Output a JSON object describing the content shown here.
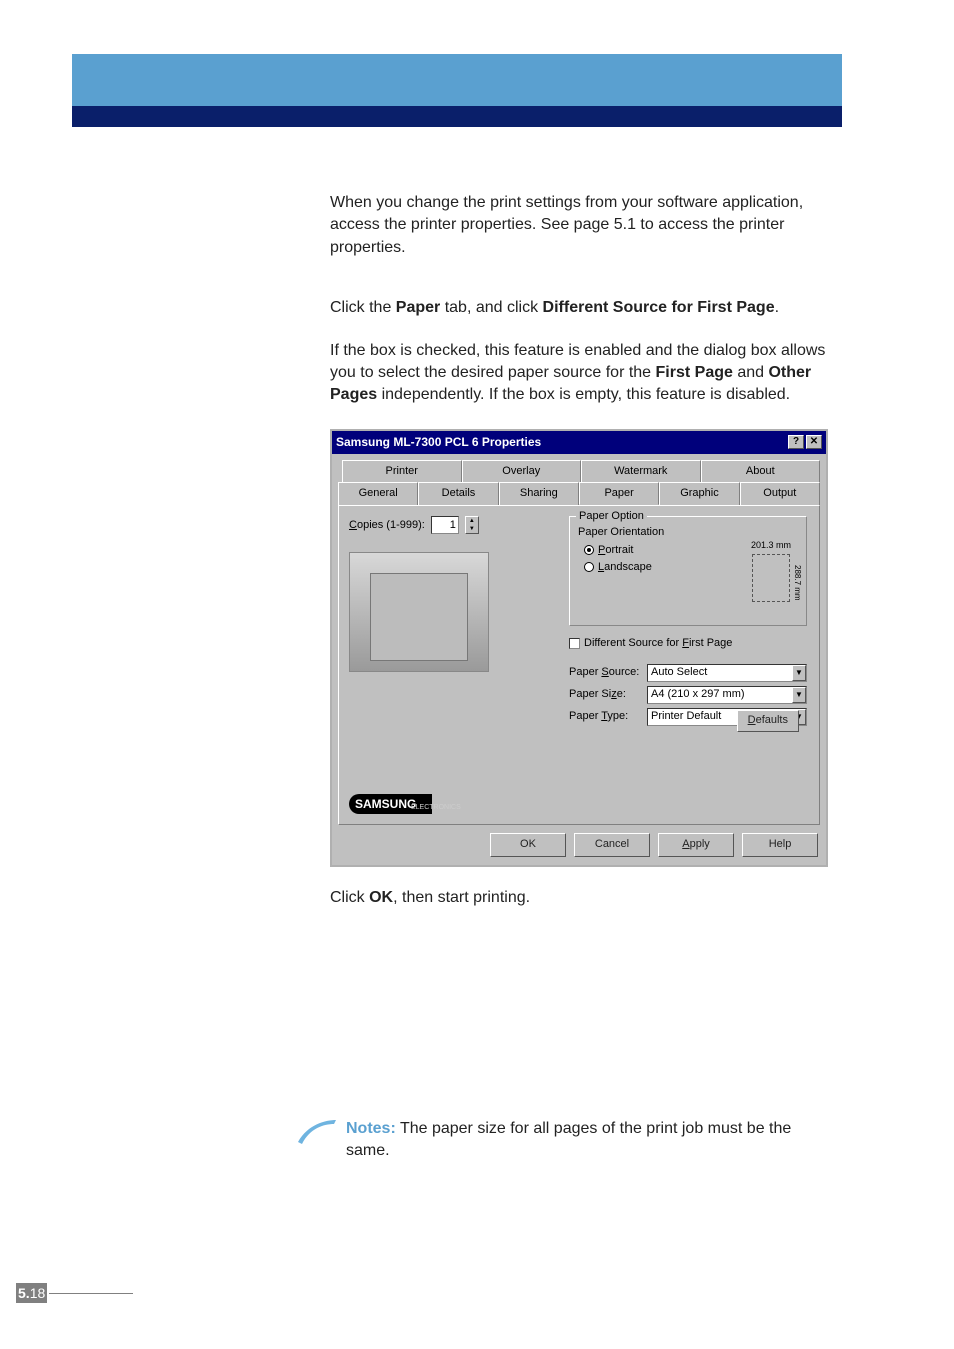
{
  "header": {},
  "paragraphs": {
    "p1": "When you change the print settings from your software application, access the printer properties. See page 5.1 to access the printer properties.",
    "p2_a": "Click the ",
    "p2_b": "Paper",
    "p2_c": " tab, and click ",
    "p2_d": "Different Source for First Page",
    "p2_e": ".",
    "p3_a": "If the box is checked, this feature is enabled and the dialog box allows you to select the desired paper source for the ",
    "p3_b": "First Page",
    "p3_c": " and ",
    "p3_d": "Other Pages",
    "p3_e": " independently. If the box is empty, this feature is disabled.",
    "p4_a": "Click ",
    "p4_b": "OK",
    "p4_c": ", then start printing."
  },
  "dialog": {
    "title": "Samsung ML-7300 PCL 6 Properties",
    "help_btn": "?",
    "close_btn": "✕",
    "tabs_upper": [
      "Printer",
      "Overlay",
      "Watermark",
      "About"
    ],
    "tabs_lower": [
      "General",
      "Details",
      "Sharing",
      "Paper",
      "Graphic",
      "Output"
    ],
    "copies_label": "Copies (1-999):",
    "copies_value": "1",
    "paper_option_label": "Paper Option",
    "orientation_label": "Paper Orientation",
    "radio_portrait": "Portrait",
    "radio_landscape": "Landscape",
    "width_label": "201.3 mm",
    "height_label": "288.7 mm",
    "diff_source_label": "Different Source for First Page",
    "source_label": "Paper Source:",
    "source_value": "Auto Select",
    "size_label": "Paper Size:",
    "size_value": "A4 (210 x 297 mm)",
    "type_label": "Paper Type:",
    "type_value": "Printer Default",
    "defaults_btn": "Defaults",
    "logo": "SAMSUNG",
    "logo_sub": "ELECTRONICS",
    "ok": "OK",
    "cancel": "Cancel",
    "apply": "Apply",
    "help": "Help"
  },
  "notes": {
    "label": "Notes:",
    "text": " The paper size for all pages of the print job must be the same."
  },
  "page": {
    "chapter": "5.",
    "num": "18"
  }
}
